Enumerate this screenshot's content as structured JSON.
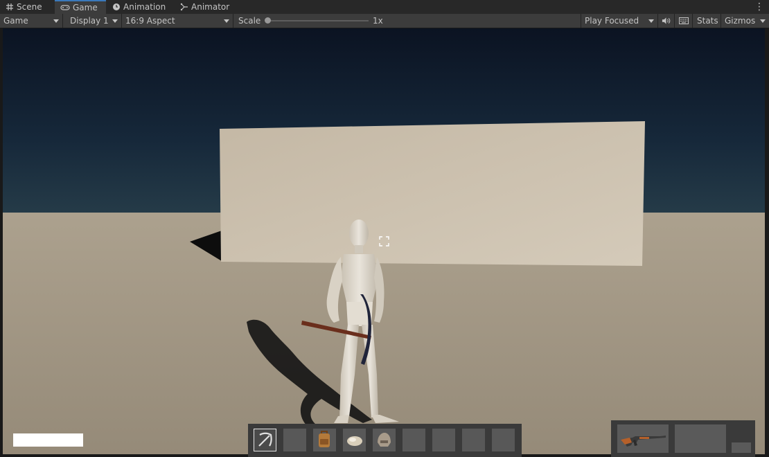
{
  "tabs": [
    {
      "label": "Scene",
      "icon": "grid-icon"
    },
    {
      "label": "Game",
      "icon": "gamepad-icon",
      "active": true
    },
    {
      "label": "Animation",
      "icon": "clock-icon"
    },
    {
      "label": "Animator",
      "icon": "animator-icon"
    }
  ],
  "toolbar": {
    "view_mode": "Game",
    "display": "Display 1",
    "aspect": "16:9 Aspect",
    "scale_label": "Scale",
    "scale_value": 0,
    "scale_readout": "1x",
    "play_mode": "Play Focused",
    "stats_label": "Stats",
    "gizmos_label": "Gizmos",
    "audio_icon": "speaker-icon",
    "keyboard_icon": "keyboard-icon",
    "menu_icon": "kebab-icon"
  },
  "scene": {
    "sky_colors": [
      "#0b1322",
      "#16283a",
      "#243a48"
    ],
    "ground_color": "#a59a88",
    "wall_color": "#cdc2b0"
  },
  "hud": {
    "hotbar_slots": [
      {
        "item": "pickaxe",
        "selected": true
      },
      {
        "item": "empty"
      },
      {
        "item": "backpack"
      },
      {
        "item": "helmet-light"
      },
      {
        "item": "helmet"
      },
      {
        "item": "empty"
      },
      {
        "item": "empty"
      },
      {
        "item": "empty"
      },
      {
        "item": "empty"
      }
    ],
    "weapon_slots": [
      {
        "item": "rifle"
      },
      {
        "item": "empty"
      }
    ],
    "health_fill": 1.0
  },
  "colors": {
    "accent": "#3a79bb",
    "toolbar_bg": "#3c3c3c",
    "tabbar_bg": "#282828"
  }
}
